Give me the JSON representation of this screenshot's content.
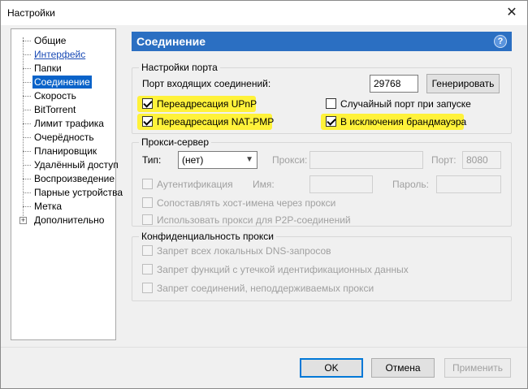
{
  "window": {
    "title": "Настройки"
  },
  "tree": {
    "items": [
      {
        "label": "Общие"
      },
      {
        "label": "Интерфейс"
      },
      {
        "label": "Папки"
      },
      {
        "label": "Соединение"
      },
      {
        "label": "Скорость"
      },
      {
        "label": "BitTorrent"
      },
      {
        "label": "Лимит трафика"
      },
      {
        "label": "Очерёдность"
      },
      {
        "label": "Планировщик"
      },
      {
        "label": "Удалённый доступ"
      },
      {
        "label": "Воспроизведение"
      },
      {
        "label": "Парные устройства"
      },
      {
        "label": "Метка"
      },
      {
        "label": "Дополнительно"
      }
    ],
    "selected": "Соединение"
  },
  "pane": {
    "title": "Соединение",
    "help_symbol": "?",
    "port_group": {
      "legend": "Настройки порта",
      "incoming_label": "Порт входящих соединений:",
      "port_value": "29768",
      "generate_button": "Генерировать",
      "upnp_label": "Переадресация UPnP",
      "upnp_checked": true,
      "natpmp_label": "Переадресация NAT-PMP",
      "natpmp_checked": true,
      "random_port_label": "Случайный порт при запуске",
      "random_port_checked": false,
      "firewall_label": "В исключения брандмауэра",
      "firewall_checked": true,
      "highlight_color": "#fff23a"
    },
    "proxy_group": {
      "legend": "Прокси-сервер",
      "type_label": "Тип:",
      "type_value": "(нет)",
      "proxy_label": "Прокси:",
      "proxy_value": "",
      "port_label": "Порт:",
      "port_value": "8080",
      "auth_label": "Аутентификация",
      "name_label": "Имя:",
      "name_value": "",
      "password_label": "Пароль:",
      "password_value": "",
      "hostnames_label": "Сопоставлять хост-имена через прокси",
      "p2p_label": "Использовать прокси для P2P-соединений"
    },
    "privacy_group": {
      "legend": "Конфиденциальность прокси",
      "dns_label": "Запрет всех локальных DNS-запросов",
      "leak_label": "Запрет функций с утечкой идентификационных данных",
      "unsupported_label": "Запрет соединений, неподдерживаемых прокси"
    }
  },
  "footer": {
    "ok": "OK",
    "cancel": "Отмена",
    "apply": "Применить"
  },
  "colors": {
    "header_bg": "#2b6fc2",
    "selection": "#0a63c9"
  }
}
